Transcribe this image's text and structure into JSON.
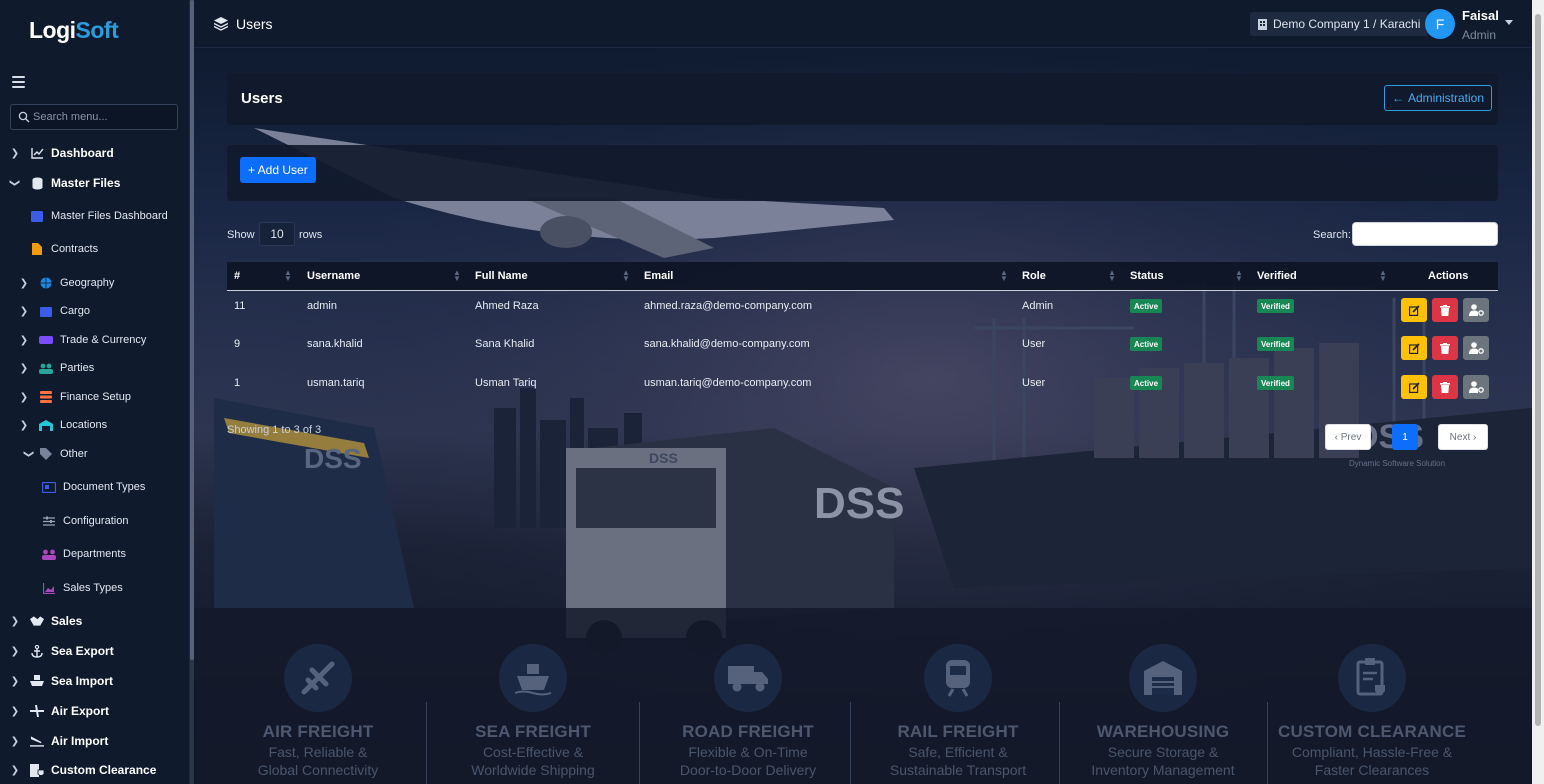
{
  "app": {
    "logo_main": "Logi",
    "logo_accent": "Soft",
    "page_title": "Users",
    "company": "Demo Company 1 / Karachi",
    "user": {
      "initial": "F",
      "name": "Faisal",
      "role": "Admin"
    }
  },
  "sidebar": {
    "search_placeholder": "Search menu...",
    "items": [
      {
        "label": "Dashboard"
      },
      {
        "label": "Master Files"
      },
      {
        "label": "Master Files Dashboard"
      },
      {
        "label": "Contracts"
      },
      {
        "label": "Geography"
      },
      {
        "label": "Cargo"
      },
      {
        "label": "Trade & Currency"
      },
      {
        "label": "Parties"
      },
      {
        "label": "Finance Setup"
      },
      {
        "label": "Locations"
      },
      {
        "label": "Other"
      },
      {
        "label": "Document Types"
      },
      {
        "label": "Configuration"
      },
      {
        "label": "Departments"
      },
      {
        "label": "Sales Types"
      },
      {
        "label": "Sales"
      },
      {
        "label": "Sea Export"
      },
      {
        "label": "Sea Import"
      },
      {
        "label": "Air Export"
      },
      {
        "label": "Air Import"
      },
      {
        "label": "Custom Clearance"
      }
    ]
  },
  "content": {
    "card_title": "Users",
    "admin_button": "Administration",
    "add_button": "+ Add User",
    "show_label": "Show",
    "rows_value": "10",
    "rows_label": "rows",
    "search_label": "Search:",
    "search_value": "",
    "columns": [
      "#",
      "Username",
      "Full Name",
      "Email",
      "Role",
      "Status",
      "Verified",
      "Actions"
    ],
    "rows": [
      {
        "id": "11",
        "username": "admin",
        "full_name": "Ahmed Raza",
        "email": "ahmed.raza@demo-company.com",
        "role": "Admin",
        "status": "Active",
        "verified": "Verified"
      },
      {
        "id": "9",
        "username": "sana.khalid",
        "full_name": "Sana Khalid",
        "email": "sana.khalid@demo-company.com",
        "role": "User",
        "status": "Active",
        "verified": "Verified"
      },
      {
        "id": "1",
        "username": "usman.tariq",
        "full_name": "Usman Tariq",
        "email": "usman.tariq@demo-company.com",
        "role": "User",
        "status": "Active",
        "verified": "Verified"
      }
    ],
    "showing_text": "Showing 1 to 3 of 3",
    "pagination": {
      "prev": "‹ Prev",
      "current": "1",
      "next": "Next ›"
    }
  },
  "services": [
    {
      "title": "AIR FREIGHT",
      "line1": "Fast, Reliable &",
      "line2": "Global Connectivity",
      "icon": "airplane-icon"
    },
    {
      "title": "SEA FREIGHT",
      "line1": "Cost-Effective &",
      "line2": "Worldwide Shipping",
      "icon": "ship-icon"
    },
    {
      "title": "ROAD FREIGHT",
      "line1": "Flexible & On-Time",
      "line2": "Door-to-Door Delivery",
      "icon": "truck-icon"
    },
    {
      "title": "RAIL FREIGHT",
      "line1": "Safe, Efficient &",
      "line2": "Sustainable Transport",
      "icon": "train-icon"
    },
    {
      "title": "WAREHOUSING",
      "line1": "Secure Storage &",
      "line2": "Inventory Management",
      "icon": "warehouse-icon"
    },
    {
      "title": "CUSTOM CLEARANCE",
      "line1": "Compliant, Hassle-Free &",
      "line2": "Faster Clearances",
      "icon": "clipboard-check-icon"
    }
  ],
  "branding": {
    "watermark": "DSS",
    "watermark_sub": "Dynamic Software Solution"
  },
  "colors": {
    "primary": "#0d6efd",
    "accent": "#2d9cdb",
    "success": "#198754",
    "warning": "#ffc107",
    "danger": "#dc3545",
    "secondary": "#6c757d",
    "sidebar_bg": "#0f1a2d"
  }
}
